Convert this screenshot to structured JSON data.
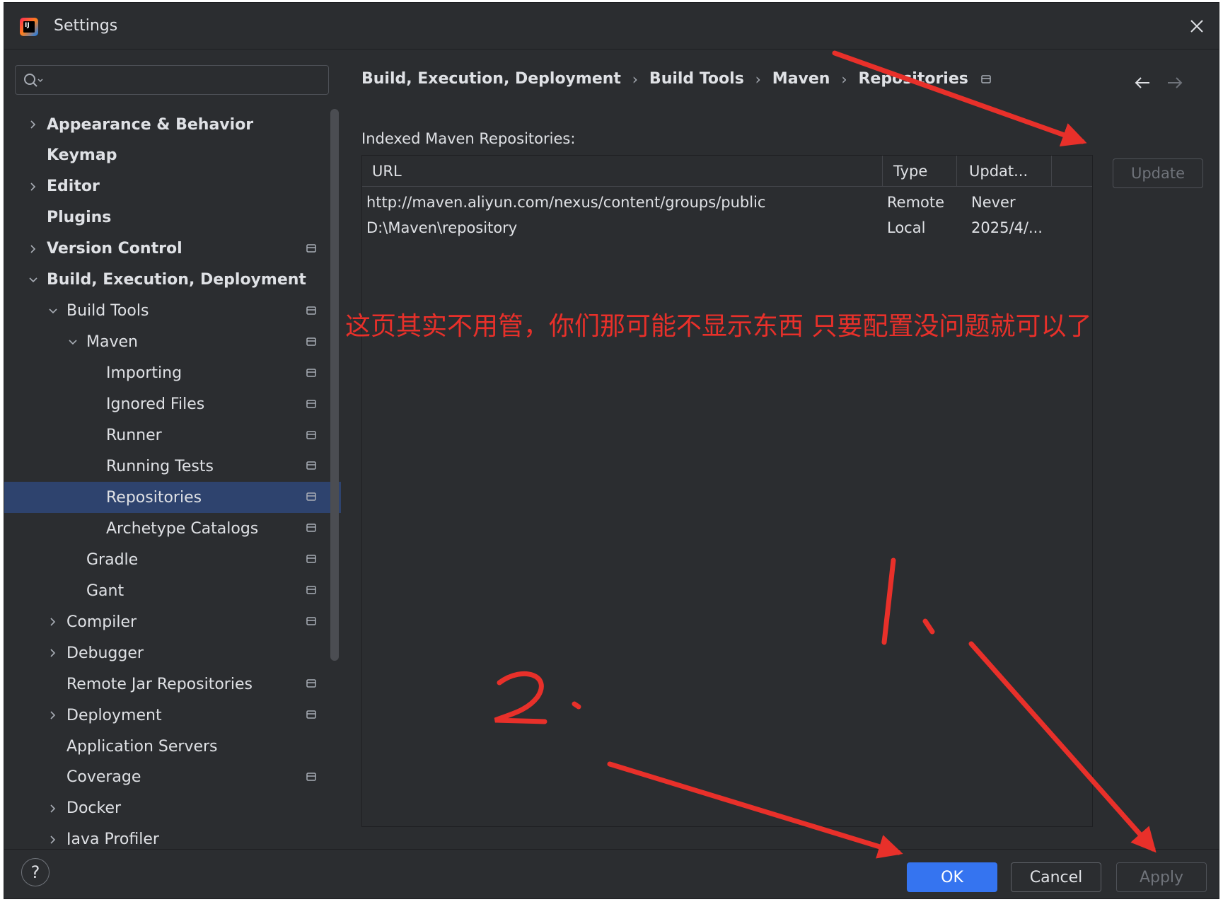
{
  "window": {
    "title": "Settings"
  },
  "search": {
    "placeholder": ""
  },
  "tree": [
    {
      "label": "Appearance & Behavior",
      "bold": true,
      "chevron": "right",
      "project": false,
      "level": 0
    },
    {
      "label": "Keymap",
      "bold": true,
      "chevron": null,
      "project": false,
      "level": 0
    },
    {
      "label": "Editor",
      "bold": true,
      "chevron": "right",
      "project": false,
      "level": 0
    },
    {
      "label": "Plugins",
      "bold": true,
      "chevron": null,
      "project": false,
      "level": 0
    },
    {
      "label": "Version Control",
      "bold": true,
      "chevron": "right",
      "project": true,
      "level": 0
    },
    {
      "label": "Build, Execution, Deployment",
      "bold": true,
      "chevron": "down",
      "project": false,
      "level": 0
    },
    {
      "label": "Build Tools",
      "bold": false,
      "chevron": "down",
      "project": true,
      "level": 1
    },
    {
      "label": "Maven",
      "bold": false,
      "chevron": "down",
      "project": true,
      "level": 2
    },
    {
      "label": "Importing",
      "bold": false,
      "chevron": null,
      "project": true,
      "level": 3
    },
    {
      "label": "Ignored Files",
      "bold": false,
      "chevron": null,
      "project": true,
      "level": 3
    },
    {
      "label": "Runner",
      "bold": false,
      "chevron": null,
      "project": true,
      "level": 3
    },
    {
      "label": "Running Tests",
      "bold": false,
      "chevron": null,
      "project": true,
      "level": 3
    },
    {
      "label": "Repositories",
      "bold": false,
      "chevron": null,
      "project": true,
      "level": 3,
      "selected": true
    },
    {
      "label": "Archetype Catalogs",
      "bold": false,
      "chevron": null,
      "project": true,
      "level": 3
    },
    {
      "label": "Gradle",
      "bold": false,
      "chevron": null,
      "project": true,
      "level": 2
    },
    {
      "label": "Gant",
      "bold": false,
      "chevron": null,
      "project": true,
      "level": 2
    },
    {
      "label": "Compiler",
      "bold": false,
      "chevron": "right",
      "project": true,
      "level": 1
    },
    {
      "label": "Debugger",
      "bold": false,
      "chevron": "right",
      "project": false,
      "level": 1
    },
    {
      "label": "Remote Jar Repositories",
      "bold": false,
      "chevron": null,
      "project": true,
      "level": 1
    },
    {
      "label": "Deployment",
      "bold": false,
      "chevron": "right",
      "project": true,
      "level": 1
    },
    {
      "label": "Application Servers",
      "bold": false,
      "chevron": null,
      "project": false,
      "level": 1
    },
    {
      "label": "Coverage",
      "bold": false,
      "chevron": null,
      "project": true,
      "level": 1
    },
    {
      "label": "Docker",
      "bold": false,
      "chevron": "right",
      "project": false,
      "level": 1
    },
    {
      "label": "Java Profiler",
      "bold": false,
      "chevron": "right",
      "project": false,
      "level": 1
    }
  ],
  "breadcrumb": [
    "Build, Execution, Deployment",
    "Build Tools",
    "Maven",
    "Repositories"
  ],
  "content": {
    "section_label": "Indexed Maven Repositories:",
    "columns": [
      "URL",
      "Type",
      "Updat..."
    ],
    "rows": [
      {
        "url": "http://maven.aliyun.com/nexus/content/groups/public",
        "type": "Remote",
        "updated": "Never"
      },
      {
        "url": "D:\\Maven\\repository",
        "type": "Local",
        "updated": "2025/4/..."
      }
    ],
    "update_label": "Update"
  },
  "annotation": {
    "note": "这页其实不用管，你们那可能不显示东西  只要配置没问题就可以了",
    "color": "#e8302a"
  },
  "footer": {
    "help": "?",
    "ok": "OK",
    "cancel": "Cancel",
    "apply": "Apply"
  },
  "colors": {
    "background": "#2b2d30",
    "selection": "#2e436e",
    "primary": "#3574f0",
    "text": "#dfe1e5"
  }
}
